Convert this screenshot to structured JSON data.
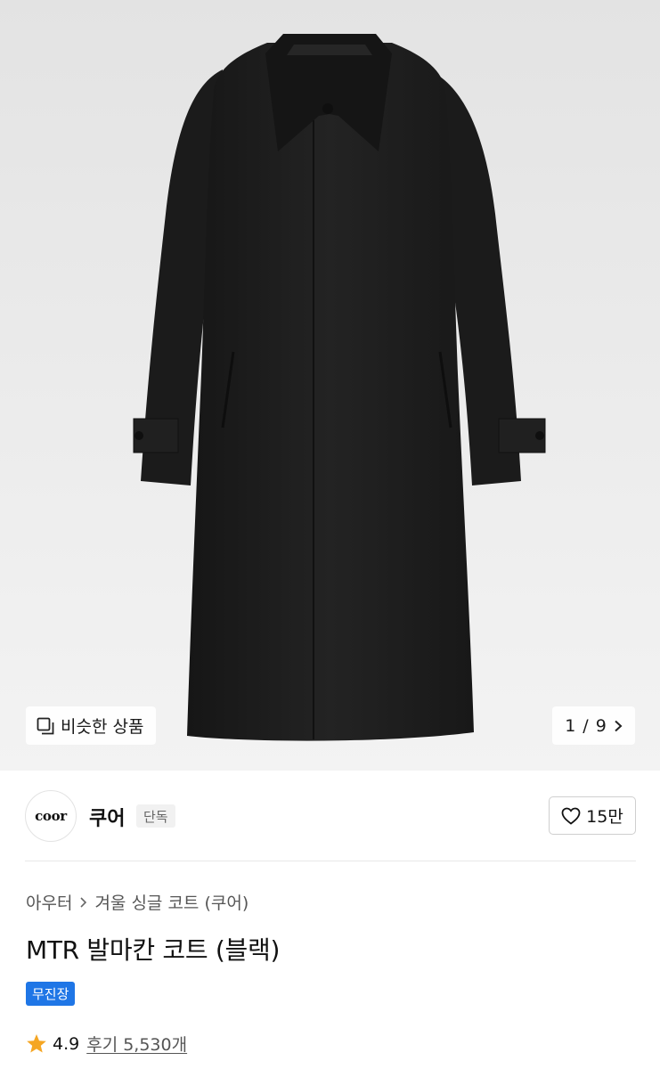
{
  "hero": {
    "similar_label": "비슷한 상품",
    "pager_current": "1",
    "pager_separator": "/",
    "pager_total": "9"
  },
  "brand": {
    "logo_text": "coor",
    "name": "쿠어",
    "badge": "단독",
    "like_count": "15만"
  },
  "breadcrumb": {
    "items": [
      "아우터",
      "겨울 싱글 코트 (쿠어)"
    ]
  },
  "product": {
    "title": "MTR 발마칸 코트 (블랙)",
    "shipping_badge": "무진장"
  },
  "rating": {
    "score": "4.9",
    "reviews": "후기 5,530개"
  },
  "colors": {
    "accent_blue": "#1f76e6",
    "star": "#f5a623",
    "coat": "#1e1e1e"
  }
}
